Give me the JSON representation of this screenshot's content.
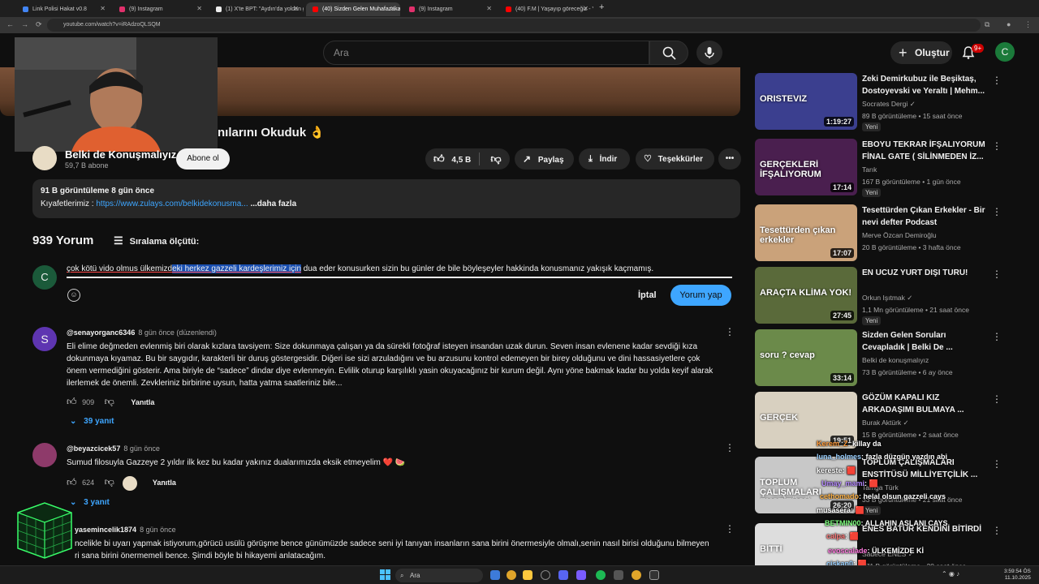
{
  "browser": {
    "tabs": [
      {
        "label": "Link Polisi Hakat v0.8",
        "color": "#4285f4"
      },
      {
        "label": "(9) Instagram",
        "color": "#e1306c"
      },
      {
        "label": "(1) X'te BPT: \"Aydın'da yoldan g",
        "color": "#eeeeee"
      },
      {
        "label": "(40) Sizden Gelen Muhafazakar",
        "color": "#ff0000"
      },
      {
        "label": "(9) Instagram",
        "color": "#e1306c"
      },
      {
        "label": "(40) F.M | Yaşayıp göreceğiz - Y",
        "color": "#ff0000"
      }
    ],
    "url": "youtube.com/watch?v=iRAdzoQLSQM"
  },
  "header": {
    "search_placeholder": "Ara",
    "create_label": "Oluştur",
    "notif_count": "9+",
    "avatar_letter": "C"
  },
  "video": {
    "title": "nılarını Okuduk 👌",
    "channel": "Belki de Konuşmalıyız",
    "subs": "59,7 B abone",
    "subscribe_label": "Abone ol",
    "likes": "4,5 B",
    "share_label": "Paylaş",
    "download_label": "İndir",
    "thanks_label": "Teşekkürler"
  },
  "description": {
    "stats": "91 B görüntüleme  8 gün önce",
    "line_prefix": "Kıyafetlerimiz : ",
    "link": "https://www.zulays.com/belkidekonusma...",
    "more": " ...daha fazla"
  },
  "comments_header": {
    "count": "939 Yorum",
    "sort_label": "Sıralama ölçütü:"
  },
  "composer": {
    "avatar_letter": "C",
    "text_pre": "çok kötü vido olmus ülkemizd",
    "text_hl": "eki herkez gazzeli kardeşlerimiz için",
    "text_post": " dua eder konusurken sizin bu günler de bile böyleşeyler hakkinda konusmanız yakışık kaçmamış.",
    "cancel_label": "İptal",
    "submit_label": "Yorum yap"
  },
  "comments": [
    {
      "avatar": "S",
      "avatar_color": "#5e35b1",
      "author": "@senayorganc6346",
      "time": "8 gün önce (düzenlendi)",
      "lines": [
        "Eli elime değmeden evlenmiş biri olarak kızlara tavsiyem: Size dokunmaya çalışan ya da sürekli fotoğraf isteyen insandan uzak durun. Seven insan evlenene kadar sevdiği kıza",
        "dokunmaya kıyamaz. Bu bir saygıdır, karakterli bir duruş göstergesidir. Diğeri ise sizi arzuladığını ve bu arzusunu kontrol edemeyen bir birey olduğunu ve dini hassasiyetlere çok",
        "önem vermediğini gösterir. Ama biriyle de “sadece” dindar diye evlenmeyin. Evlilik oturup karşılıklı yasin okuyacağınız bir kurum değil. Aynı yöne bakmak kadar bu yolda keyif alarak",
        "ilerlemek de önemli. Zevkleriniz birbirine uysun, hatta yatma saatleriniz bile..."
      ],
      "likes": "909",
      "reply_label": "Yanıtla",
      "replies": "39 yanıt"
    },
    {
      "avatar": "",
      "avatar_color": "#8e3a6a",
      "author": "@beyazcicek57",
      "time": "8 gün önce",
      "lines": [
        "Sumud filosuyla Gazzeye 2 yıldır ilk kez bu kadar yakınız dualarımızda eksik etmeyelim ❤️ 🍉"
      ],
      "likes": "624",
      "reply_label": "Yanıtla",
      "replies": "3 yanıt"
    },
    {
      "avatar": "",
      "avatar_color": "#444444",
      "author": "yasemincelik1874",
      "time": "8 gün önce",
      "lines": [
        "ncelikle bi uyarı yapmak istiyorum,görücü usülü görüşme bence günümüzde sadece seni iyi tanıyan insanların sana birini önermesiyle olmalı,senin nasıl birisi olduğunu bilmeyen",
        "ri sana birini önermemeli bence. Şimdi böyle bi hikayemi anlatacağım."
      ]
    }
  ],
  "related": [
    {
      "title": "Zeki Demirkubuz ile Beşiktaş, Dostoyevski ve Yeraltı | Mehm...",
      "channel": "Socrates Dergi ✓",
      "meta": "89 B görüntüleme • 15 saat önce",
      "duration": "1:19:27",
      "new": "Yeni",
      "thumb": "#3b3f8f",
      "thumb_text": "ORISTEVIZ"
    },
    {
      "title": "EBOYU TEKRAR İFŞALIYORUM FİNAL GATE ( SİLİNMEDEN İZ...",
      "channel": "Tarık",
      "meta": "167 B görüntüleme • 1 gün önce",
      "duration": "17:14",
      "new": "Yeni",
      "thumb": "#4a1f4f",
      "thumb_text": "GERÇEKLERİ İFŞALIYORUM"
    },
    {
      "title": "Tesettürden Çıkan Erkekler - Bir nevi defter Podcast",
      "channel": "Merve Özcan Demiroğlu",
      "meta": "20 B görüntüleme • 3 hafta önce",
      "duration": "17:07",
      "new": "",
      "thumb": "#caa27a",
      "thumb_text": "Tesettürden çıkan erkekler"
    },
    {
      "title": "EN UCUZ YURT DIŞI TURU!",
      "channel": "Orkun Işıtmak ✓",
      "meta": "1,1 Mn görüntüleme • 21 saat önce",
      "duration": "27:45",
      "new": "Yeni",
      "thumb": "#5a6a3a",
      "thumb_text": "ARAÇTA KLİMA YOK!"
    },
    {
      "title": "Sizden Gelen Soruları Cevapladık | Belki De ...",
      "channel": "Belki de konuşmalıyız",
      "meta": "73 B görüntüleme • 6 ay önce",
      "duration": "33:14",
      "new": "",
      "thumb": "#6b8a4a",
      "thumb_text": "soru ? cevap"
    },
    {
      "title": "GÖZÜM KAPALI KIZ ARKADAŞIMI BULMAYA ...",
      "channel": "Burak Aktürk ✓",
      "meta": "15 B görüntüleme • 2 saat önce",
      "duration": "19:51",
      "new": "",
      "thumb": "#d8d0c0",
      "thumb_text": "GERÇEK"
    },
    {
      "title": "TOPLUM ÇALIŞMALARI ENSTİTÜSÜ MİLLİYETÇİLİK ...",
      "channel": "Tamga Türk",
      "meta": "33 B görüntüleme • 21 saat önce",
      "duration": "26:20",
      "new": "Yeni",
      "thumb": "#c8c8c8",
      "thumb_text": "TOPLUM ÇALIŞMALARI ENSTİTÜSÜ"
    },
    {
      "title": "ENES BATUR KENDİNİ BİTİRDİ",
      "channel": "Sadece ENES ✓",
      "meta": "471 B görüntüleme • 20 saat önce",
      "duration": "",
      "new": "",
      "thumb": "#ddd",
      "thumb_text": "BİTTİ"
    }
  ],
  "chat": [
    {
      "user": "Kerem_Z",
      "msg": ": killay da",
      "color": "#ff9b3a"
    },
    {
      "user": "luna_holmes",
      "msg": ": fazla düzgün yazdın abi",
      "color": "#9ad0ff"
    },
    {
      "user": "kereste",
      "msg": ": 🟥",
      "color": "#ffffff"
    },
    {
      "user": "Umay_mami",
      "msg": ": 🟥",
      "color": "#b68aff"
    },
    {
      "user": "cethomado",
      "msg": ": helal olsun gazzeli cays",
      "color": "#ffb347"
    },
    {
      "user": "musasera",
      "msg": ": 🟥",
      "color": "#ffffff"
    },
    {
      "user": "BETMIN00",
      "msg": ": ALLAHIN ASLANI CAYS",
      "color": "#7fff7f"
    },
    {
      "user": "calpa",
      "msg": ": 🟥",
      "color": "#ff7a7a"
    },
    {
      "user": "evoscalade",
      "msg": ": ÜLKEMİZDE Kİ",
      "color": "#ff7adf"
    },
    {
      "user": "ciskan0",
      "msg": ": 🟥",
      "color": "#9ad0ff"
    }
  ],
  "taskbar": {
    "search": "Ara",
    "time": "3:59:54 ÖS",
    "date": "11.10.2025"
  }
}
